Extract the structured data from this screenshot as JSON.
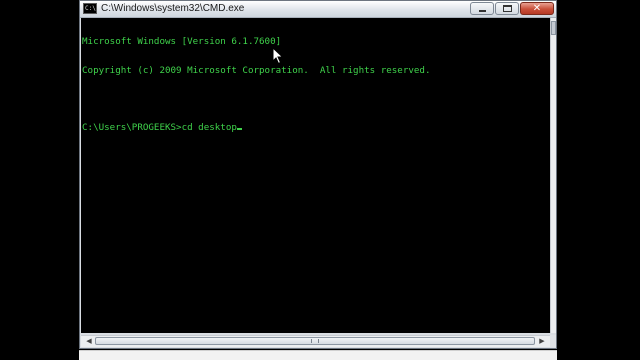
{
  "window": {
    "title": "C:\\Windows\\system32\\CMD.exe",
    "icon_label": "C:\\",
    "buttons": {
      "minimize_icon": "minimize-icon",
      "maximize_icon": "maximize-icon",
      "close_icon": "close-icon",
      "close_glyph": "✕"
    }
  },
  "console": {
    "lines": [
      "Microsoft Windows [Version 6.1.7600]",
      "Copyright (c) 2009 Microsoft Corporation.  All rights reserved.",
      ""
    ],
    "prompt": "C:\\Users\\PROGEEKS>",
    "typed_command": "cd desktop",
    "text_color": "#3fd24b",
    "background_color": "#000000"
  },
  "scrollbars": {
    "left_arrow": "◀",
    "right_arrow": "▶"
  }
}
